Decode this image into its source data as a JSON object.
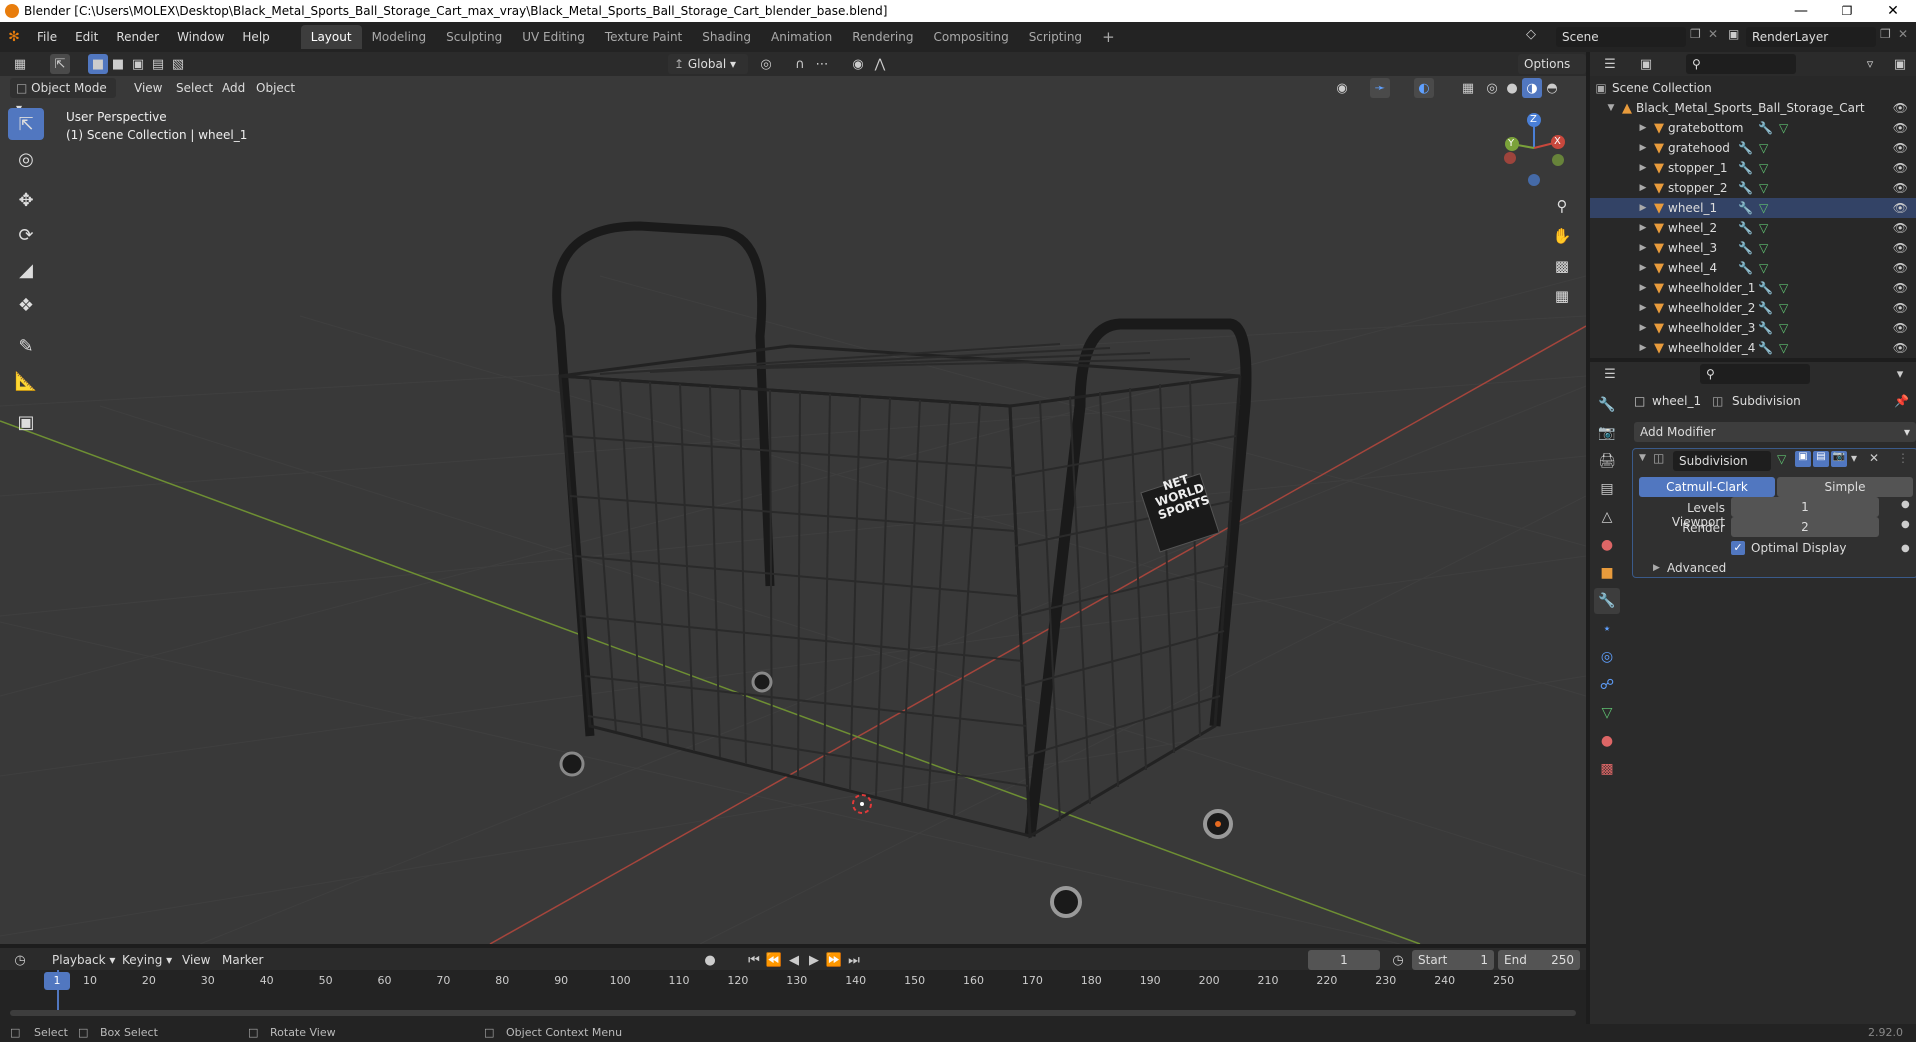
{
  "window": {
    "title": "Blender [C:\\Users\\MOLEX\\Desktop\\Black_Metal_Sports_Ball_Storage_Cart_max_vray\\Black_Metal_Sports_Ball_Storage_Cart_blender_base.blend]"
  },
  "menu": [
    "File",
    "Edit",
    "Render",
    "Window",
    "Help"
  ],
  "workspaces": [
    "Layout",
    "Modeling",
    "Sculpting",
    "UV Editing",
    "Texture Paint",
    "Shading",
    "Animation",
    "Rendering",
    "Compositing",
    "Scripting"
  ],
  "scene": {
    "label": "Scene",
    "render_layer": "RenderLayer"
  },
  "viewport": {
    "orientation": "Global",
    "options": "Options",
    "mode": "Object Mode",
    "menus": [
      "View",
      "Select",
      "Add",
      "Object"
    ],
    "overlay_title": "User Perspective",
    "overlay_sub": "(1) Scene Collection | wheel_1",
    "sign_text": "NET WORLD SPORTS"
  },
  "gizmo": {
    "x": "X",
    "y": "Y",
    "z": "Z"
  },
  "outliner": {
    "root": "Scene Collection",
    "collection": "Black_Metal_Sports_Ball_Storage_Cart",
    "items": [
      "gratebottom",
      "gratehood",
      "stopper_1",
      "stopper_2",
      "wheel_1",
      "wheel_2",
      "wheel_3",
      "wheel_4",
      "wheelholder_1",
      "wheelholder_2",
      "wheelholder_3",
      "wheelholder_4"
    ]
  },
  "properties": {
    "object": "wheel_1",
    "modifier_ref": "Subdivision",
    "add_modifier": "Add Modifier",
    "modifier_name": "Subdivision",
    "types": [
      "Catmull-Clark",
      "Simple"
    ],
    "levels_viewport_label": "Levels Viewport",
    "levels_viewport": "1",
    "render_label": "Render",
    "render": "2",
    "optimal_display": "Optimal Display",
    "advanced": "Advanced"
  },
  "timeline": {
    "menus": [
      "Playback",
      "Keying",
      "View",
      "Marker"
    ],
    "current_frame": "1",
    "start_label": "Start",
    "start": "1",
    "end_label": "End",
    "end": "250",
    "ticks": [
      "1",
      "10",
      "20",
      "30",
      "40",
      "50",
      "60",
      "70",
      "80",
      "90",
      "100",
      "110",
      "120",
      "130",
      "140",
      "150",
      "160",
      "170",
      "180",
      "190",
      "200",
      "210",
      "220",
      "230",
      "240",
      "250"
    ]
  },
  "status": {
    "select": "Select",
    "box_select": "Box Select",
    "rotate": "Rotate View",
    "context": "Object Context Menu",
    "version": "2.92.0"
  },
  "colors": {
    "accent": "#5177c0",
    "x_axis": "#c8483d",
    "y_axis": "#7ba23a",
    "z_axis": "#4a7fd6"
  }
}
